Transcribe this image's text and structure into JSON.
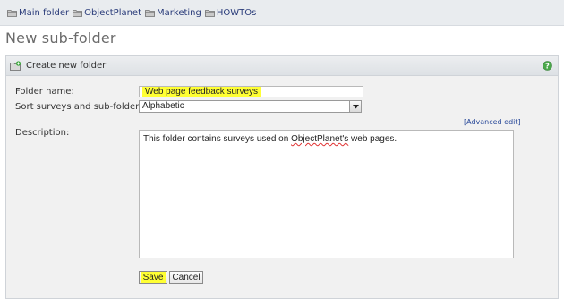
{
  "breadcrumb": {
    "items": [
      {
        "label": "Main folder"
      },
      {
        "label": "ObjectPlanet"
      },
      {
        "label": "Marketing"
      },
      {
        "label": "HOWTOs"
      }
    ]
  },
  "page": {
    "title": "New sub-folder"
  },
  "panel": {
    "title": "Create new folder",
    "folder_name_label": "Folder name:",
    "folder_name_value": "Web page feedback surveys",
    "sort_label": "Sort surveys and sub-folders:",
    "sort_value": "Alphabetic",
    "advanced_edit": "[Advanced edit]",
    "description_label": "Description:",
    "description_parts": {
      "before": "This folder contains surveys used on ",
      "misspelled": "ObjectPlanet's",
      "after": " web pages."
    },
    "save_label": "Save",
    "cancel_label": "Cancel"
  },
  "colors": {
    "highlight": "#ffff33",
    "link": "#2a4a9a",
    "title": "#6b6b6b"
  },
  "icons": {
    "breadcrumb": "folder-icon",
    "panel_header": "new-folder-icon",
    "help": "help-icon",
    "select": "chevron-down-icon"
  }
}
